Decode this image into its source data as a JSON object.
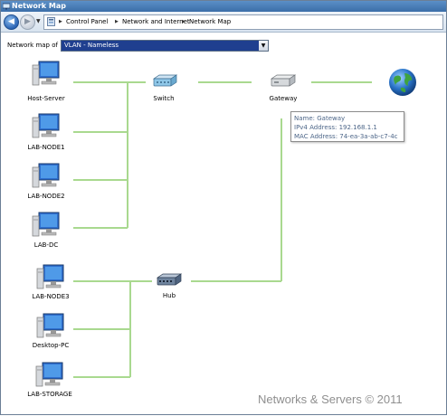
{
  "window": {
    "title": "Network Map"
  },
  "nav": {
    "back_icon": "back-arrow-icon",
    "forward_icon": "forward-arrow-icon",
    "breadcrumbs": [
      "Control Panel",
      "Network and Internet",
      "Network Map"
    ]
  },
  "toolbar": {
    "network_label": "Network map of",
    "network_value": "VLAN - Nameless"
  },
  "devices": {
    "host_server": "Host-Server",
    "lab_node1": "LAB-NODE1",
    "lab_node2": "LAB-NODE2",
    "lab_dc": "LAB-DC",
    "lab_node3": "LAB-NODE3",
    "desktop_pc": "Desktop-PC",
    "lab_storage": "LAB-STORAGE",
    "switch": "Switch",
    "gateway": "Gateway",
    "hub": "Hub"
  },
  "tooltip": {
    "name": "Name: Gateway",
    "ipv4": "IPv4 Address: 192.168.1.1",
    "mac": "MAC Address: 74-ea-3a-ab-c7-4c"
  },
  "watermark": "Networks & Servers © 2011",
  "colors": {
    "link": "#a9d98f",
    "select_bg": "#1f3f8f",
    "title_bg": "#3b6ea8"
  }
}
